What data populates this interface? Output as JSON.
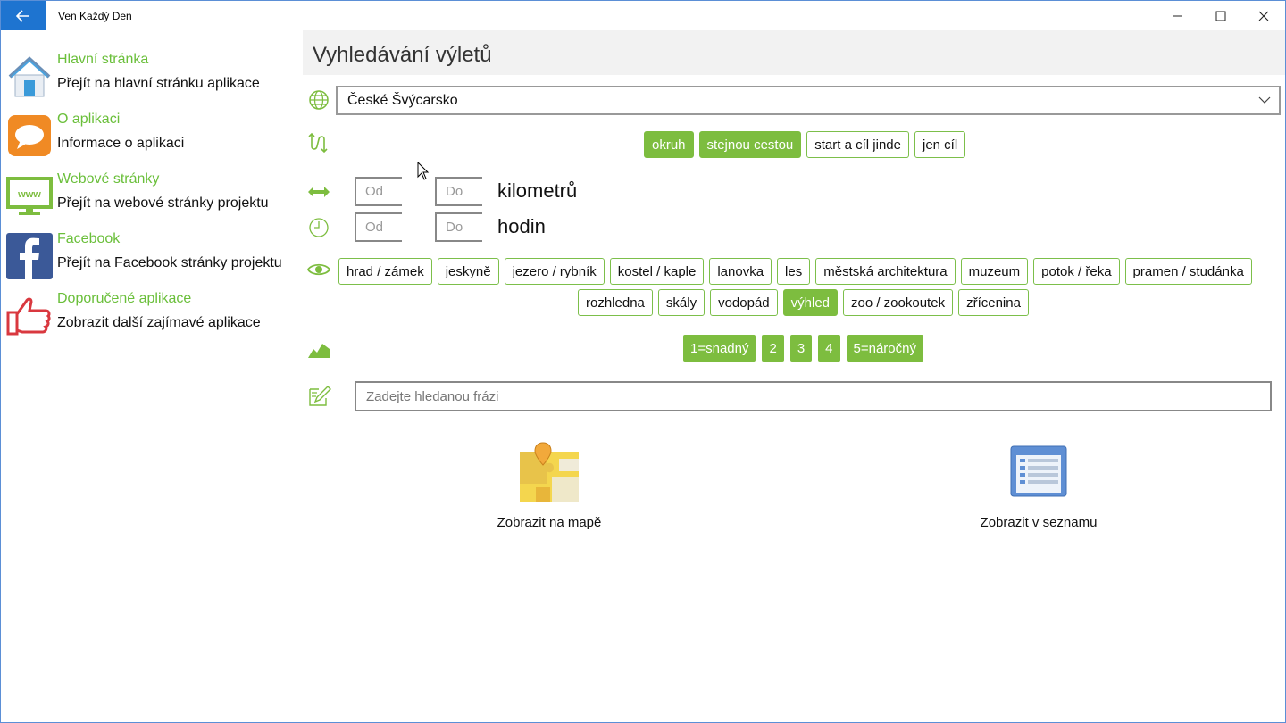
{
  "window": {
    "title": "Ven Každý Den",
    "back_icon": "back-arrow-icon",
    "controls": {
      "minimize": "—",
      "maximize": "☐",
      "close": "✕"
    }
  },
  "sidebar": {
    "items": [
      {
        "title": "Hlavní stránka",
        "subtitle": "Přejít na hlavní stránku aplikace",
        "icon": "home-icon"
      },
      {
        "title": "O aplikaci",
        "subtitle": "Informace o aplikaci",
        "icon": "speech-bubble-icon"
      },
      {
        "title": "Webové stránky",
        "subtitle": "Přejít na webové stránky projektu",
        "icon": "www-monitor-icon"
      },
      {
        "title": "Facebook",
        "subtitle": "Přejít na Facebook stránky projektu",
        "icon": "facebook-icon"
      },
      {
        "title": "Doporučené aplikace",
        "subtitle": "Zobrazit další zajímavé aplikace",
        "icon": "thumbs-up-icon"
      }
    ]
  },
  "main": {
    "title": "Vyhledávání výletů",
    "region": {
      "value": "České Švýcarsko"
    },
    "route_types": [
      {
        "label": "okruh",
        "selected": true
      },
      {
        "label": "stejnou cestou",
        "selected": true
      },
      {
        "label": "start a cíl jinde",
        "selected": false
      },
      {
        "label": "jen cíl",
        "selected": false
      }
    ],
    "distance": {
      "from_placeholder": "Od",
      "to_placeholder": "Do",
      "unit": "kilometrů"
    },
    "duration": {
      "from_placeholder": "Od",
      "to_placeholder": "Do",
      "unit": "hodin"
    },
    "sights_row1": [
      {
        "label": "hrad / zámek",
        "selected": false
      },
      {
        "label": "jeskyně",
        "selected": false
      },
      {
        "label": "jezero / rybník",
        "selected": false
      },
      {
        "label": "kostel / kaple",
        "selected": false
      },
      {
        "label": "lanovka",
        "selected": false
      },
      {
        "label": "les",
        "selected": false
      },
      {
        "label": "městská architektura",
        "selected": false
      },
      {
        "label": "muzeum",
        "selected": false
      },
      {
        "label": "potok / řeka",
        "selected": false
      },
      {
        "label": "pramen / studánka",
        "selected": false
      }
    ],
    "sights_row2": [
      {
        "label": "rozhledna",
        "selected": false
      },
      {
        "label": "skály",
        "selected": false
      },
      {
        "label": "vodopád",
        "selected": false
      },
      {
        "label": "výhled",
        "selected": true
      },
      {
        "label": "zoo / zookoutek",
        "selected": false
      },
      {
        "label": "zřícenina",
        "selected": false
      }
    ],
    "difficulty": [
      "1=snadný",
      "2",
      "3",
      "4",
      "5=náročný"
    ],
    "search": {
      "placeholder": "Zadejte hledanou frázi"
    },
    "actions": {
      "map_label": "Zobrazit na mapě",
      "list_label": "Zobrazit v seznamu"
    },
    "accent_color": "#7dbd3f",
    "title_bar_accent": "#1e74d0"
  }
}
